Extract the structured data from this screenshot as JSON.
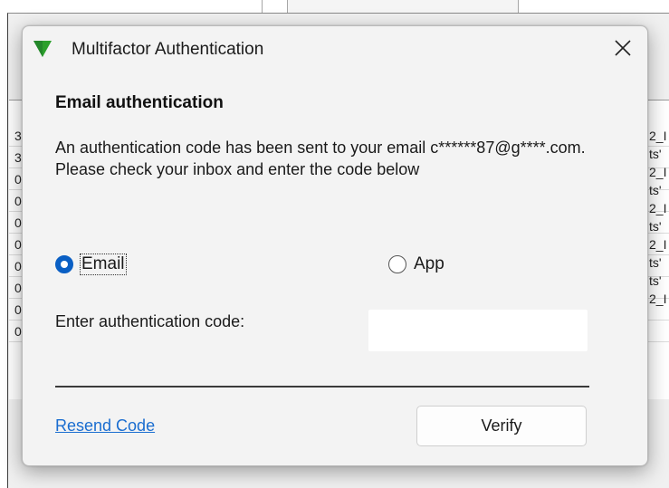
{
  "dialog": {
    "title": "Multifactor Authentication",
    "icon": "green-triangle-down-icon",
    "close_icon": "close-icon",
    "heading": "Email authentication",
    "message": "An authentication code has been sent to your email c******87@g****.com. Please check your inbox and enter the code below",
    "options": {
      "email_label": "Email",
      "email_selected": true,
      "app_label": "App",
      "app_selected": false
    },
    "code_label": "Enter authentication code:",
    "code_value": "",
    "resend_label": "Resend Code",
    "verify_label": "Verify"
  },
  "background": {
    "left_cells": [
      "3",
      "3",
      "0",
      "0",
      "0",
      "0",
      "0",
      "0",
      "0",
      "0"
    ],
    "right_cells": [
      "2_I",
      "ts'",
      "2_I",
      "ts'",
      "2_I",
      "ts'",
      "2_I",
      "ts'",
      "ts'",
      "2_I"
    ]
  },
  "colors": {
    "accent": "#0a5fc4",
    "link": "#1a6dd0",
    "icon_green": "#2ca02c"
  }
}
